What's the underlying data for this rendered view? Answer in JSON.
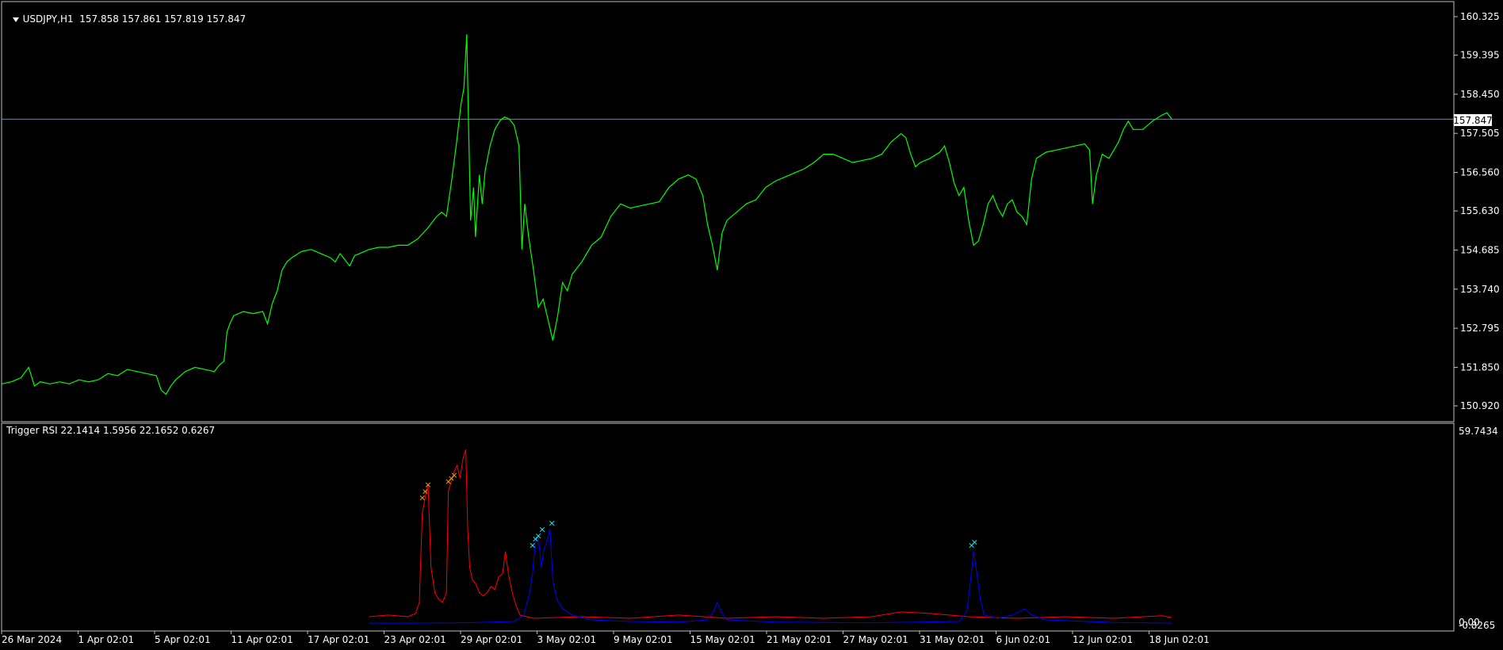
{
  "main_panel": {
    "symbol_label": "USDJPY,H1",
    "ohlc_label": "157.858 157.861 157.819 157.847",
    "current_price_label": "157.847",
    "price_ticks": [
      "160.325",
      "159.395",
      "158.450",
      "157.505",
      "156.560",
      "155.630",
      "154.685",
      "153.740",
      "152.795",
      "151.850",
      "150.920"
    ]
  },
  "indicator_panel": {
    "title": "Trigger RSI 22.1414 1.5956 22.1652 0.6267",
    "scale_top": "59.7434",
    "scale_zero": "0.00",
    "scale_bottom": "-0.8265"
  },
  "time_axis": [
    "26 Mar 2024",
    "1 Apr 02:01",
    "5 Apr 02:01",
    "11 Apr 02:01",
    "17 Apr 02:01",
    "23 Apr 02:01",
    "29 Apr 02:01",
    "3 May 02:01",
    "9 May 02:01",
    "15 May 02:01",
    "21 May 02:01",
    "27 May 02:01",
    "31 May 02:01",
    "6 Jun 02:01",
    "12 Jun 02:01",
    "18 Jun 02:01"
  ],
  "colors": {
    "price_line": "#00ff00",
    "grid_line": "#c0c0c0",
    "bid_line": "#778899",
    "rsi_red": "#ff0000",
    "rsi_blue": "#0000ff",
    "marker_orange": "#ffa500",
    "marker_cyan": "#00ffff"
  },
  "chart_data": {
    "type": "line",
    "title": "USDJPY,H1",
    "ylim": [
      150.5,
      160.8
    ],
    "series": [
      {
        "name": "USDJPY,H1",
        "points": [
          [
            0,
            151.45
          ],
          [
            10,
            151.5
          ],
          [
            20,
            151.6
          ],
          [
            28,
            151.85
          ],
          [
            34,
            151.4
          ],
          [
            40,
            151.5
          ],
          [
            50,
            151.45
          ],
          [
            60,
            151.5
          ],
          [
            70,
            151.45
          ],
          [
            80,
            151.55
          ],
          [
            90,
            151.5
          ],
          [
            100,
            151.55
          ],
          [
            110,
            151.7
          ],
          [
            120,
            151.65
          ],
          [
            130,
            151.8
          ],
          [
            140,
            151.75
          ],
          [
            150,
            151.7
          ],
          [
            160,
            151.65
          ],
          [
            165,
            151.3
          ],
          [
            170,
            151.2
          ],
          [
            175,
            151.4
          ],
          [
            180,
            151.55
          ],
          [
            190,
            151.75
          ],
          [
            200,
            151.85
          ],
          [
            210,
            151.8
          ],
          [
            220,
            151.75
          ],
          [
            225,
            151.9
          ],
          [
            230,
            152.0
          ],
          [
            233,
            152.7
          ],
          [
            236,
            152.9
          ],
          [
            240,
            153.1
          ],
          [
            250,
            153.2
          ],
          [
            260,
            153.15
          ],
          [
            270,
            153.2
          ],
          [
            275,
            152.9
          ],
          [
            280,
            153.4
          ],
          [
            285,
            153.7
          ],
          [
            290,
            154.2
          ],
          [
            295,
            154.4
          ],
          [
            300,
            154.5
          ],
          [
            310,
            154.65
          ],
          [
            320,
            154.7
          ],
          [
            330,
            154.6
          ],
          [
            340,
            154.5
          ],
          [
            345,
            154.4
          ],
          [
            350,
            154.6
          ],
          [
            360,
            154.3
          ],
          [
            365,
            154.55
          ],
          [
            370,
            154.6
          ],
          [
            380,
            154.7
          ],
          [
            390,
            154.75
          ],
          [
            400,
            154.75
          ],
          [
            410,
            154.8
          ],
          [
            420,
            154.8
          ],
          [
            430,
            154.95
          ],
          [
            440,
            155.2
          ],
          [
            450,
            155.5
          ],
          [
            455,
            155.6
          ],
          [
            460,
            155.5
          ],
          [
            465,
            156.3
          ],
          [
            470,
            157.2
          ],
          [
            475,
            158.2
          ],
          [
            478,
            158.6
          ],
          [
            481,
            159.9
          ],
          [
            483,
            157.5
          ],
          [
            485,
            155.4
          ],
          [
            488,
            156.2
          ],
          [
            490,
            155.0
          ],
          [
            494,
            156.5
          ],
          [
            497,
            155.8
          ],
          [
            500,
            156.6
          ],
          [
            505,
            157.2
          ],
          [
            510,
            157.6
          ],
          [
            515,
            157.8
          ],
          [
            520,
            157.9
          ],
          [
            525,
            157.85
          ],
          [
            530,
            157.7
          ],
          [
            535,
            157.2
          ],
          [
            538,
            154.7
          ],
          [
            541,
            155.8
          ],
          [
            545,
            155.0
          ],
          [
            550,
            154.2
          ],
          [
            555,
            153.3
          ],
          [
            560,
            153.5
          ],
          [
            565,
            153.0
          ],
          [
            570,
            152.5
          ],
          [
            575,
            153.1
          ],
          [
            580,
            153.9
          ],
          [
            585,
            153.7
          ],
          [
            590,
            154.1
          ],
          [
            600,
            154.4
          ],
          [
            610,
            154.8
          ],
          [
            620,
            155.0
          ],
          [
            630,
            155.5
          ],
          [
            640,
            155.8
          ],
          [
            650,
            155.7
          ],
          [
            660,
            155.75
          ],
          [
            670,
            155.8
          ],
          [
            680,
            155.85
          ],
          [
            690,
            156.2
          ],
          [
            700,
            156.4
          ],
          [
            710,
            156.5
          ],
          [
            718,
            156.4
          ],
          [
            725,
            156.0
          ],
          [
            730,
            155.3
          ],
          [
            735,
            154.8
          ],
          [
            740,
            154.2
          ],
          [
            745,
            155.1
          ],
          [
            750,
            155.4
          ],
          [
            760,
            155.6
          ],
          [
            770,
            155.8
          ],
          [
            780,
            155.9
          ],
          [
            790,
            156.2
          ],
          [
            800,
            156.35
          ],
          [
            810,
            156.45
          ],
          [
            820,
            156.55
          ],
          [
            830,
            156.65
          ],
          [
            840,
            156.8
          ],
          [
            850,
            157.0
          ],
          [
            860,
            157.0
          ],
          [
            870,
            156.9
          ],
          [
            880,
            156.8
          ],
          [
            890,
            156.85
          ],
          [
            900,
            156.9
          ],
          [
            910,
            157.0
          ],
          [
            920,
            157.3
          ],
          [
            930,
            157.5
          ],
          [
            935,
            157.4
          ],
          [
            940,
            157.0
          ],
          [
            945,
            156.7
          ],
          [
            950,
            156.8
          ],
          [
            960,
            156.9
          ],
          [
            970,
            157.05
          ],
          [
            975,
            157.2
          ],
          [
            980,
            156.8
          ],
          [
            985,
            156.3
          ],
          [
            990,
            156.0
          ],
          [
            995,
            156.2
          ],
          [
            1000,
            155.4
          ],
          [
            1005,
            154.8
          ],
          [
            1010,
            154.9
          ],
          [
            1015,
            155.3
          ],
          [
            1020,
            155.8
          ],
          [
            1025,
            156.0
          ],
          [
            1030,
            155.7
          ],
          [
            1035,
            155.5
          ],
          [
            1040,
            155.8
          ],
          [
            1045,
            155.9
          ],
          [
            1050,
            155.6
          ],
          [
            1055,
            155.5
          ],
          [
            1060,
            155.3
          ],
          [
            1065,
            156.4
          ],
          [
            1070,
            156.9
          ],
          [
            1080,
            157.05
          ],
          [
            1090,
            157.1
          ],
          [
            1100,
            157.15
          ],
          [
            1110,
            157.2
          ],
          [
            1120,
            157.25
          ],
          [
            1125,
            157.1
          ],
          [
            1128,
            155.8
          ],
          [
            1132,
            156.5
          ],
          [
            1138,
            157.0
          ],
          [
            1145,
            156.9
          ],
          [
            1150,
            157.1
          ],
          [
            1155,
            157.3
          ],
          [
            1160,
            157.6
          ],
          [
            1165,
            157.8
          ],
          [
            1170,
            157.6
          ],
          [
            1180,
            157.6
          ],
          [
            1190,
            157.8
          ],
          [
            1200,
            157.95
          ],
          [
            1205,
            158.0
          ],
          [
            1210,
            157.85
          ]
        ]
      }
    ]
  },
  "indicator_data": {
    "type": "line",
    "title": "Trigger RSI 22.1414 1.5956 22.1652 0.6267",
    "ylim": [
      -0.8265,
      59.7434
    ],
    "series": [
      {
        "name": "",
        "color": "#ff0000",
        "points": [
          [
            380,
            2.5
          ],
          [
            400,
            3.0
          ],
          [
            420,
            2.5
          ],
          [
            428,
            3.5
          ],
          [
            432,
            7
          ],
          [
            435,
            35
          ],
          [
            438,
            40
          ],
          [
            441,
            44
          ],
          [
            444,
            18
          ],
          [
            448,
            10
          ],
          [
            452,
            8
          ],
          [
            456,
            7
          ],
          [
            460,
            10
          ],
          [
            462,
            42
          ],
          [
            465,
            45
          ],
          [
            468,
            48
          ],
          [
            471,
            50
          ],
          [
            474,
            46
          ],
          [
            477,
            52
          ],
          [
            480,
            55
          ],
          [
            482,
            30
          ],
          [
            484,
            18
          ],
          [
            487,
            14
          ],
          [
            490,
            13
          ],
          [
            494,
            10
          ],
          [
            498,
            9
          ],
          [
            502,
            10
          ],
          [
            506,
            12
          ],
          [
            510,
            11
          ],
          [
            514,
            15
          ],
          [
            518,
            16
          ],
          [
            521,
            23
          ],
          [
            524,
            16
          ],
          [
            528,
            10
          ],
          [
            532,
            6
          ],
          [
            536,
            3
          ],
          [
            550,
            2
          ],
          [
            600,
            2.5
          ],
          [
            650,
            2
          ],
          [
            700,
            3
          ],
          [
            750,
            2
          ],
          [
            800,
            2.5
          ],
          [
            850,
            2
          ],
          [
            900,
            2.5
          ],
          [
            930,
            4
          ],
          [
            960,
            3.5
          ],
          [
            1000,
            2.5
          ],
          [
            1050,
            2
          ],
          [
            1100,
            2.5
          ],
          [
            1150,
            2
          ],
          [
            1200,
            2.8
          ],
          [
            1210,
            2.2
          ]
        ]
      },
      {
        "name": "",
        "color": "#0000ff",
        "points": [
          [
            380,
            0.5
          ],
          [
            430,
            0.5
          ],
          [
            480,
            0.6
          ],
          [
            530,
            1.0
          ],
          [
            540,
            3
          ],
          [
            546,
            10
          ],
          [
            549,
            16
          ],
          [
            552,
            26
          ],
          [
            555,
            28
          ],
          [
            558,
            18
          ],
          [
            561,
            24
          ],
          [
            564,
            26
          ],
          [
            567,
            30
          ],
          [
            570,
            14
          ],
          [
            574,
            8
          ],
          [
            580,
            5
          ],
          [
            590,
            3
          ],
          [
            610,
            1.5
          ],
          [
            650,
            1.0
          ],
          [
            700,
            0.8
          ],
          [
            730,
            1.5
          ],
          [
            736,
            4
          ],
          [
            740,
            7
          ],
          [
            744,
            4
          ],
          [
            750,
            1.5
          ],
          [
            800,
            0.8
          ],
          [
            850,
            0.7
          ],
          [
            900,
            0.6
          ],
          [
            950,
            0.8
          ],
          [
            990,
            1.0
          ],
          [
            998,
            4
          ],
          [
            1002,
            14
          ],
          [
            1005,
            23
          ],
          [
            1008,
            17
          ],
          [
            1012,
            8
          ],
          [
            1016,
            3
          ],
          [
            1030,
            2
          ],
          [
            1045,
            3
          ],
          [
            1058,
            5
          ],
          [
            1065,
            3
          ],
          [
            1080,
            1.5
          ],
          [
            1150,
            0.7
          ],
          [
            1210,
            0.5
          ]
        ]
      }
    ],
    "markers": [
      {
        "x": 435,
        "y": 40,
        "color": "#ffa500"
      },
      {
        "x": 438,
        "y": 42,
        "color": "#ffa500"
      },
      {
        "x": 441,
        "y": 44,
        "color": "#ffa500"
      },
      {
        "x": 462,
        "y": 45,
        "color": "#ffa500"
      },
      {
        "x": 465,
        "y": 46,
        "color": "#ffa500"
      },
      {
        "x": 468,
        "y": 47,
        "color": "#ffa500"
      },
      {
        "x": 549,
        "y": 25,
        "color": "#00ffff"
      },
      {
        "x": 552,
        "y": 27,
        "color": "#00ffff"
      },
      {
        "x": 555,
        "y": 28,
        "color": "#00ffff"
      },
      {
        "x": 559,
        "y": 30,
        "color": "#00ffff"
      },
      {
        "x": 569,
        "y": 32,
        "color": "#00ffff"
      },
      {
        "x": 1003,
        "y": 25,
        "color": "#00ffff"
      },
      {
        "x": 1006,
        "y": 26,
        "color": "#00ffff"
      }
    ]
  }
}
